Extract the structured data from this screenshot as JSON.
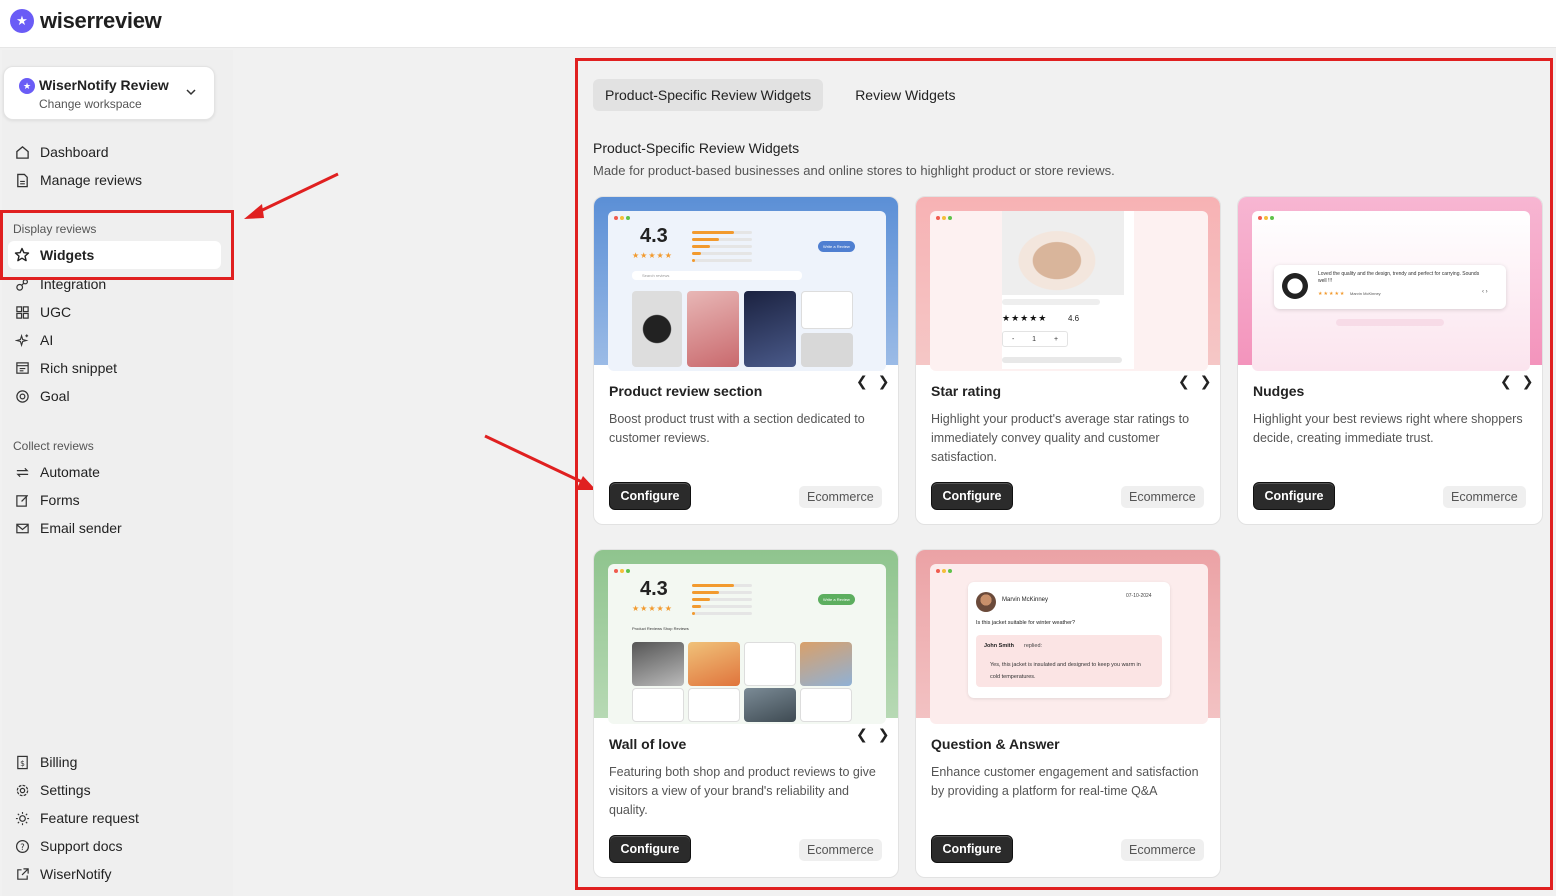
{
  "app": {
    "logo_text": "wiserreview"
  },
  "workspace": {
    "name": "WiserNotify Review",
    "sub": "Change workspace"
  },
  "sidebar": {
    "top_items": [
      {
        "label": "Dashboard",
        "icon": "home-icon"
      },
      {
        "label": "Manage reviews",
        "icon": "document-icon"
      }
    ],
    "display_section": "Display reviews",
    "display_items": [
      {
        "label": "Widgets",
        "icon": "star-icon"
      },
      {
        "label": "Integration",
        "icon": "link-icon"
      },
      {
        "label": "UGC",
        "icon": "grid-icon"
      },
      {
        "label": "AI",
        "icon": "sparkle-icon"
      },
      {
        "label": "Rich snippet",
        "icon": "snippet-icon"
      },
      {
        "label": "Goal",
        "icon": "target-icon"
      }
    ],
    "collect_section": "Collect reviews",
    "collect_items": [
      {
        "label": "Automate",
        "icon": "repeat-icon"
      },
      {
        "label": "Forms",
        "icon": "edit-icon"
      },
      {
        "label": "Email sender",
        "icon": "mail-icon"
      }
    ],
    "bottom_items": [
      {
        "label": "Billing",
        "icon": "receipt-icon"
      },
      {
        "label": "Settings",
        "icon": "gear-icon"
      },
      {
        "label": "Feature request",
        "icon": "sun-icon"
      },
      {
        "label": "Support docs",
        "icon": "help-icon"
      },
      {
        "label": "WiserNotify",
        "icon": "external-link-icon"
      }
    ]
  },
  "tabs": [
    "Product-Specific Review Widgets",
    "Review Widgets"
  ],
  "section": {
    "title": "Product-Specific Review Widgets",
    "desc": "Made for product-based businesses and online stores to highlight product or store reviews."
  },
  "cards": [
    {
      "title": "Product review section",
      "desc": "Boost product trust with a section dedicated to customer reviews.",
      "button": "Configure",
      "tag": "Ecommerce"
    },
    {
      "title": "Star rating",
      "desc": "Highlight your product's average star ratings to immediately convey quality and customer satisfaction.",
      "button": "Configure",
      "tag": "Ecommerce"
    },
    {
      "title": "Nudges",
      "desc": "Highlight your best reviews right where shoppers decide, creating immediate trust.",
      "button": "Configure",
      "tag": "Ecommerce"
    },
    {
      "title": "Wall of love",
      "desc": "Featuring both shop and product reviews to give visitors a view of your brand's reliability and quality.",
      "button": "Configure",
      "tag": "Ecommerce"
    },
    {
      "title": "Question & Answer",
      "desc": "Enhance customer engagement and satisfaction by providing a platform for real-time Q&A",
      "button": "Configure",
      "tag": "Ecommerce"
    }
  ],
  "previews": {
    "rating": "4.3",
    "stars": "★★★★★",
    "write_review": "Write a Review",
    "search_placeholder": "Search reviews",
    "star_rating_value": "4.6",
    "qty_minus": "-",
    "qty_value": "1",
    "qty_plus": "+",
    "nudge_text": "Loved the quality and the design, trendy and perfect for carrying. Sounds well !!!",
    "nudge_author": "Marvin McKinney",
    "qa_name": "Marvin McKinney",
    "qa_date": "07-10-2024",
    "qa_question": "Is this jacket suitable for winter weather?",
    "qa_replier": "John Smith",
    "qa_replied": "replied:",
    "qa_answer": "Yes, this jacket is insulated and designed to keep you warm in cold temperatures.",
    "wall_tabs": "Product Reviews   Shop Reviews"
  },
  "colors": {
    "accent_red": "#e02020",
    "brand_purple": "#6a5cf6",
    "star_orange": "#f29a2e"
  }
}
